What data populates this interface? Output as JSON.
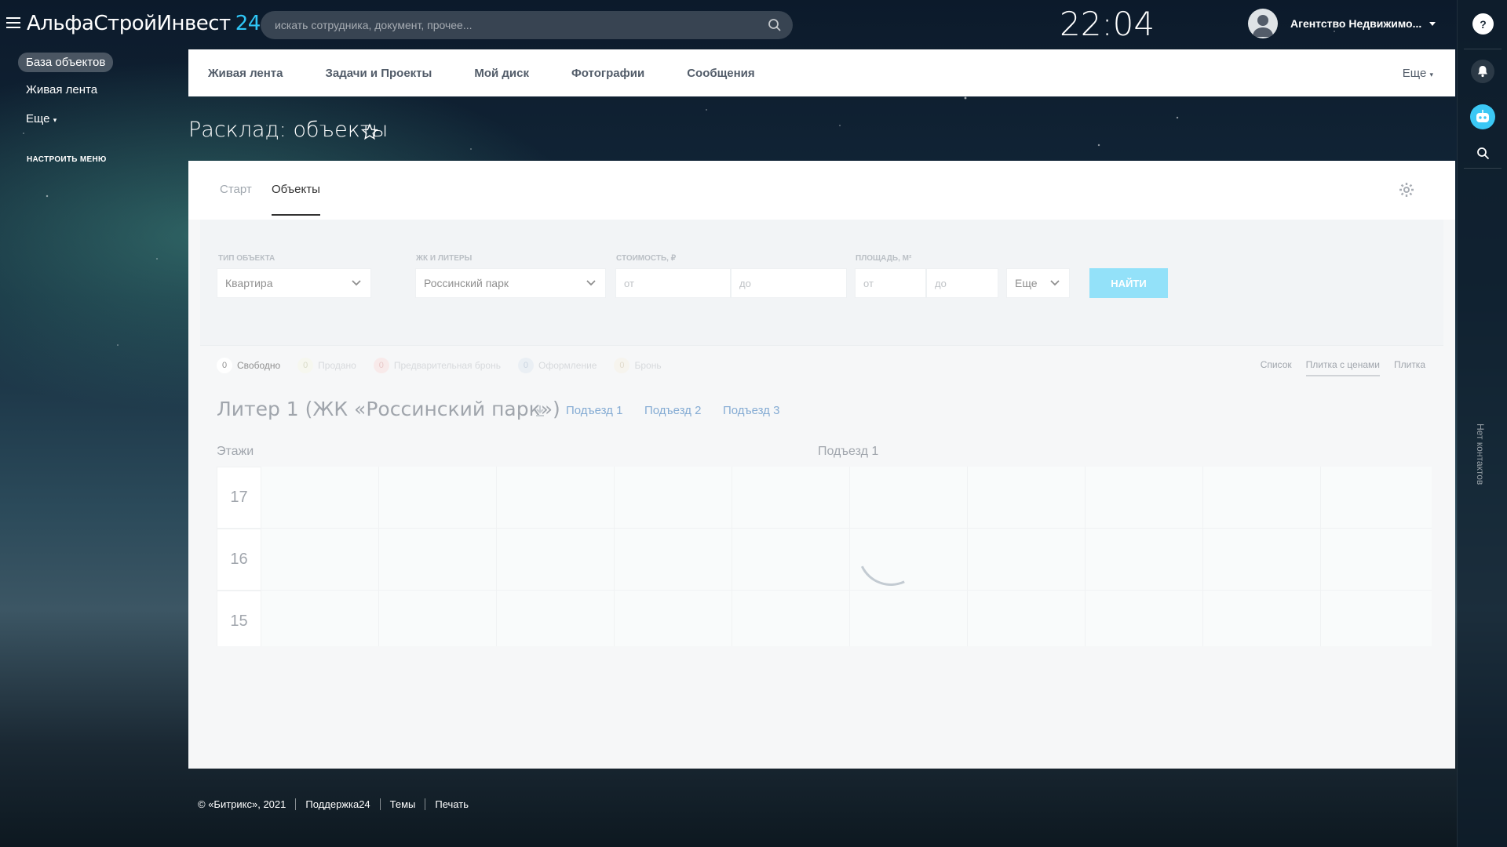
{
  "header": {
    "logo_text": "АльфаСтройИнвест",
    "logo_number": "24",
    "search_placeholder": "искать сотрудника, документ, прочее...",
    "clock": "22:04",
    "user_name": "Агентство Недвижимо..."
  },
  "left_menu": {
    "items": [
      {
        "label": "База объектов",
        "active": true
      },
      {
        "label": "Живая лента"
      },
      {
        "label": "Еще"
      }
    ],
    "setup": "НАСТРОИТЬ МЕНЮ"
  },
  "top_nav": {
    "items": [
      "Живая лента",
      "Задачи и Проекты",
      "Мой диск",
      "Фотографии",
      "Сообщения"
    ],
    "more": "Еще"
  },
  "page_title": "Расклад: объекты",
  "tabs": [
    "Старт",
    "Объекты"
  ],
  "filter": {
    "type_label": "ТИП ОБЪЕКТА",
    "type_value": "Квартира",
    "complex_label": "ЖК И ЛИТЕРЫ",
    "complex_value": "Россинский парк",
    "price_label": "СТОИМОСТЬ, ₽",
    "area_label": "ПЛОЩАДЬ, М²",
    "from": "от",
    "to": "до",
    "more": "Еще",
    "search_button": "НАЙТИ"
  },
  "statuses": [
    {
      "count": "0",
      "label": "Свободно",
      "color": "#333333",
      "bg": "#ffffff"
    },
    {
      "count": "0",
      "label": "Продано",
      "color": "#b8bd9a",
      "bg": "#eef0e2"
    },
    {
      "count": "0",
      "label": "Предварительная бронь",
      "color": "#d59a9a",
      "bg": "#f3d9d9"
    },
    {
      "count": "0",
      "label": "Оформление",
      "color": "#9fb1c6",
      "bg": "#d9e2ec"
    },
    {
      "count": "0",
      "label": "Бронь",
      "color": "#c9bda5",
      "bg": "#efebe1"
    }
  ],
  "views": [
    {
      "label": "Список"
    },
    {
      "label": "Плитка с ценами",
      "active": true
    },
    {
      "label": "Плитка"
    }
  ],
  "building": {
    "title": "Литер 1 (ЖК «Россинский парк»)",
    "entrances": [
      "Подъезд 1",
      "Подъезд 2",
      "Подъезд 3"
    ],
    "floors_label": "Этажи",
    "entrance_label": "Подъезд 1",
    "floors": [
      "17",
      "16",
      "15"
    ]
  },
  "right_panel": {
    "no_contacts": "Нет контактов"
  },
  "footer": [
    "© «Битрикс», 2021",
    "Поддержка24",
    "Темы",
    "Печать"
  ],
  "colors": {
    "accent": "#3bc8f5",
    "link": "#2067b0",
    "brand_number": "#2fc6f6"
  }
}
